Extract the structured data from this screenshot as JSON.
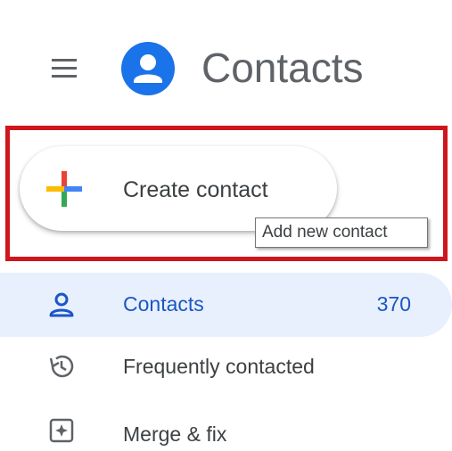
{
  "header": {
    "menu_icon": "hamburger-menu-icon",
    "logo_icon": "contacts-person-icon",
    "title": "Contacts",
    "logo_color": "#1a73e8"
  },
  "create": {
    "label": "Create contact",
    "icon": "plus-icon",
    "tooltip": "Add new contact",
    "highlight_color": "#d0161d"
  },
  "nav": {
    "items": [
      {
        "label": "Contacts",
        "count": "370",
        "icon": "person-icon",
        "active": true
      },
      {
        "label": "Frequently contacted",
        "icon": "history-icon",
        "active": false
      },
      {
        "label": "Merge & fix",
        "icon": "merge-fix-icon",
        "active": false
      }
    ]
  },
  "colors": {
    "accent": "#1a56c5",
    "active_bg": "#e8f0fe",
    "text": "#3c4043"
  }
}
